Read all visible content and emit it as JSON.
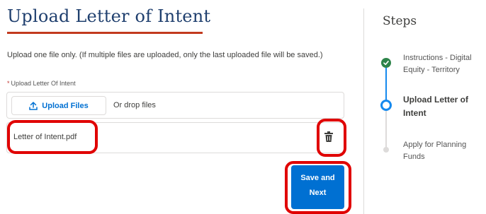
{
  "page": {
    "title": "Upload Letter of Intent",
    "instructions": "Upload one file only.  (If multiple files are uploaded, only the last uploaded file will be saved.)"
  },
  "upload_field": {
    "required_marker": "*",
    "label": "Upload Letter Of Intent",
    "upload_button_label": "Upload Files",
    "upload_icon": "upload-icon",
    "drop_text": "Or drop files"
  },
  "uploaded_file": {
    "name": "Letter of Intent.pdf",
    "delete_icon": "trash-icon"
  },
  "actions": {
    "save_line1": "Save and",
    "save_line2": "Next"
  },
  "steps": {
    "title": "Steps",
    "items": [
      {
        "label": "Instructions - Digital Equity - Territory",
        "status": "complete"
      },
      {
        "label": "Upload Letter of Intent",
        "status": "current"
      },
      {
        "label": "Apply for Planning Funds",
        "status": "upcoming"
      }
    ]
  },
  "colors": {
    "title": "#1f3f6e",
    "title_underline": "#c23a1f",
    "accent_blue": "#0070d2",
    "step_complete": "#2e844a",
    "step_current": "#1589ee",
    "annotation_red": "#e00000"
  }
}
